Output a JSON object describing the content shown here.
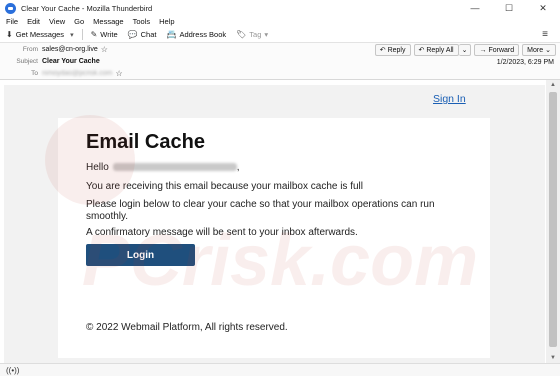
{
  "window": {
    "title": "Clear Your Cache - Mozilla Thunderbird",
    "minimize": "—",
    "maximize": "☐",
    "close": "✕"
  },
  "menu": [
    "File",
    "Edit",
    "View",
    "Go",
    "Message",
    "Tools",
    "Help"
  ],
  "toolbar": {
    "get_messages": "Get Messages",
    "write": "Write",
    "chat": "Chat",
    "address_book": "Address Book",
    "tag": "Tag",
    "menu_icon": "hamburger-icon"
  },
  "header": {
    "from_label": "From",
    "from_value": "sales@cn-org.live",
    "subject_label": "Subject",
    "subject_value": "Clear Your Cache",
    "to_label": "To",
    "to_value": "nimoydas@pcrisk.com",
    "date": "1/2/2023, 6:29 PM",
    "actions": {
      "reply": "Reply",
      "reply_all": "Reply All",
      "forward": "Forward",
      "more": "More"
    }
  },
  "email": {
    "signin_link": "Sign In",
    "title": "Email Cache",
    "hello": "Hello",
    "hello_suffix": ",",
    "hello_recipient": "nimoydas@pcrisk.com",
    "line1": "You are receiving this email because your mailbox cache is full",
    "line2": "Please login below to clear your cache so that your mailbox operations can run smoothly.",
    "line3": "A confirmatory message will be sent to your inbox afterwards.",
    "login_button": "Login",
    "footer": "© 2022 Webmail Platform, All rights reserved."
  },
  "watermark": "PCrisk.com",
  "colors": {
    "login_button": "#1f4f7d",
    "link": "#1a5fb4",
    "outer_bg": "#f2f2f2"
  }
}
